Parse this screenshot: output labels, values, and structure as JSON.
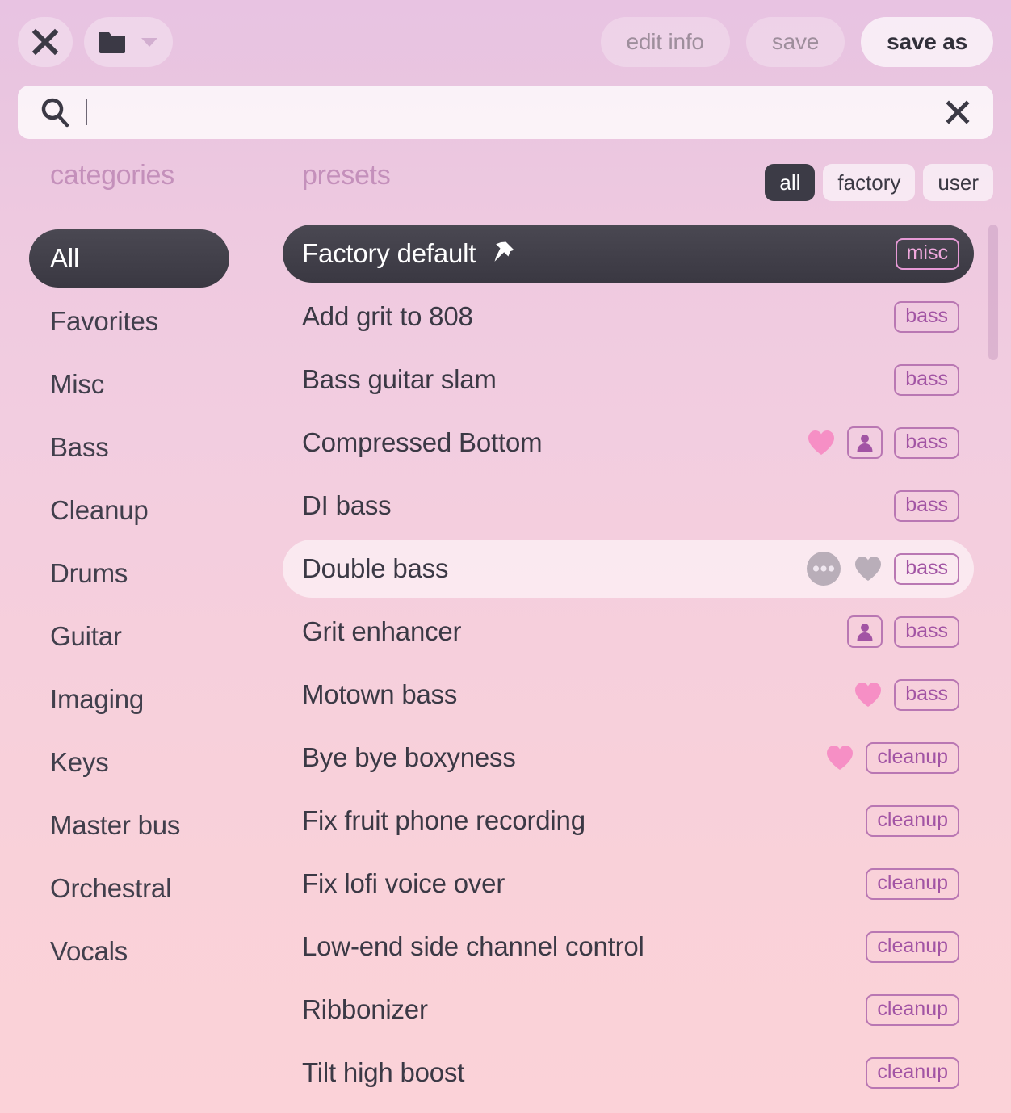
{
  "header": {
    "close_icon": "close-icon",
    "folder_icon": "folder-icon",
    "folder_chevron_icon": "chevron-down-icon",
    "buttons": [
      {
        "label": "edit info",
        "state": "disabled"
      },
      {
        "label": "save",
        "state": "disabled"
      },
      {
        "label": "save as",
        "state": "active"
      }
    ]
  },
  "search": {
    "icon": "search-icon",
    "value": "",
    "placeholder": "",
    "clear_icon": "close-icon"
  },
  "columns": {
    "categories_heading": "categories",
    "presets_heading": "presets"
  },
  "source_filter": {
    "options": [
      "all",
      "factory",
      "user"
    ],
    "selected": "all"
  },
  "categories": {
    "items": [
      {
        "label": "All",
        "selected": true
      },
      {
        "label": "Favorites",
        "selected": false
      },
      {
        "label": "Misc",
        "selected": false
      },
      {
        "label": "Bass",
        "selected": false
      },
      {
        "label": "Cleanup",
        "selected": false
      },
      {
        "label": "Drums",
        "selected": false
      },
      {
        "label": "Guitar",
        "selected": false
      },
      {
        "label": "Imaging",
        "selected": false
      },
      {
        "label": "Keys",
        "selected": false
      },
      {
        "label": "Master bus",
        "selected": false
      },
      {
        "label": "Orchestral",
        "selected": false
      },
      {
        "label": "Vocals",
        "selected": false
      }
    ]
  },
  "presets": {
    "rows": [
      {
        "name": "Factory default",
        "tag": "misc",
        "selected": true,
        "hovered": false,
        "pinned": true,
        "favorite": false,
        "user": false,
        "more": false
      },
      {
        "name": "Add grit to 808",
        "tag": "bass",
        "selected": false,
        "hovered": false,
        "pinned": false,
        "favorite": false,
        "user": false,
        "more": false
      },
      {
        "name": "Bass guitar slam",
        "tag": "bass",
        "selected": false,
        "hovered": false,
        "pinned": false,
        "favorite": false,
        "user": false,
        "more": false
      },
      {
        "name": "Compressed Bottom",
        "tag": "bass",
        "selected": false,
        "hovered": false,
        "pinned": false,
        "favorite": true,
        "user": true,
        "more": false
      },
      {
        "name": "DI bass",
        "tag": "bass",
        "selected": false,
        "hovered": false,
        "pinned": false,
        "favorite": false,
        "user": false,
        "more": false
      },
      {
        "name": "Double bass",
        "tag": "bass",
        "selected": false,
        "hovered": true,
        "pinned": false,
        "favorite": "outline",
        "user": false,
        "more": true
      },
      {
        "name": "Grit enhancer",
        "tag": "bass",
        "selected": false,
        "hovered": false,
        "pinned": false,
        "favorite": false,
        "user": true,
        "more": false
      },
      {
        "name": "Motown bass",
        "tag": "bass",
        "selected": false,
        "hovered": false,
        "pinned": false,
        "favorite": true,
        "user": false,
        "more": false
      },
      {
        "name": "Bye bye boxyness",
        "tag": "cleanup",
        "selected": false,
        "hovered": false,
        "pinned": false,
        "favorite": true,
        "user": false,
        "more": false
      },
      {
        "name": "Fix fruit phone recording",
        "tag": "cleanup",
        "selected": false,
        "hovered": false,
        "pinned": false,
        "favorite": false,
        "user": false,
        "more": false
      },
      {
        "name": "Fix lofi voice over",
        "tag": "cleanup",
        "selected": false,
        "hovered": false,
        "pinned": false,
        "favorite": false,
        "user": false,
        "more": false
      },
      {
        "name": "Low-end side channel control",
        "tag": "cleanup",
        "selected": false,
        "hovered": false,
        "pinned": false,
        "favorite": false,
        "user": false,
        "more": false
      },
      {
        "name": "Ribbonizer",
        "tag": "cleanup",
        "selected": false,
        "hovered": false,
        "pinned": false,
        "favorite": false,
        "user": false,
        "more": false
      },
      {
        "name": "Tilt high boost",
        "tag": "cleanup",
        "selected": false,
        "hovered": false,
        "pinned": false,
        "favorite": false,
        "user": false,
        "more": false
      }
    ]
  },
  "colors": {
    "accent_pink": "#f590c4",
    "tag_purple": "#a254a4",
    "selected_dark": "#3c3b46",
    "heading_pink": "#c490bb",
    "background_top": "#e8c3e2",
    "background_bottom": "#fbd2d8"
  }
}
